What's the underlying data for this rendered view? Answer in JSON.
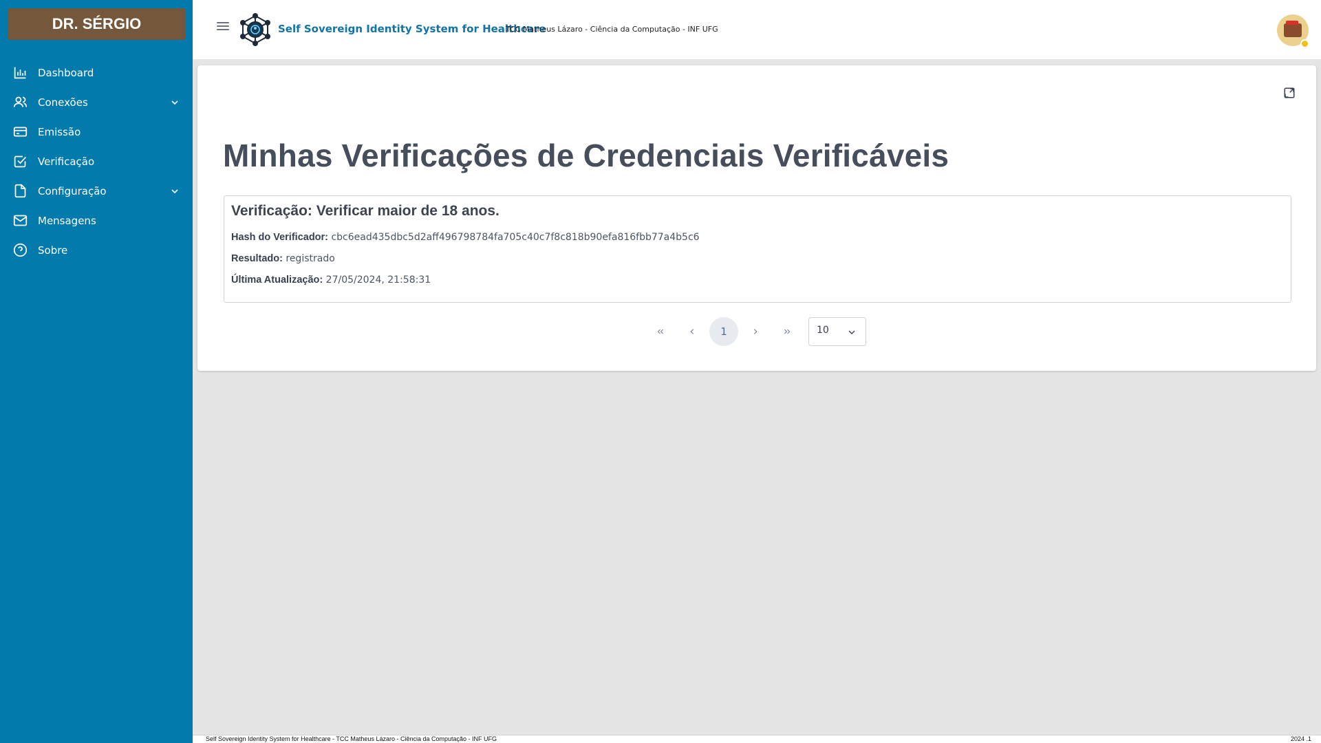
{
  "user": {
    "name": "DR. SÉRGIO"
  },
  "sidebar": {
    "items": [
      {
        "label": "Dashboard",
        "icon": "bar-chart-icon"
      },
      {
        "label": "Conexões",
        "icon": "users-icon",
        "expandable": true
      },
      {
        "label": "Emissão",
        "icon": "credit-card-icon"
      },
      {
        "label": "Verificação",
        "icon": "check-square-icon"
      },
      {
        "label": "Configuração",
        "icon": "file-icon",
        "expandable": true
      },
      {
        "label": "Mensagens",
        "icon": "mail-icon"
      },
      {
        "label": "Sobre",
        "icon": "help-circle-icon"
      }
    ]
  },
  "header": {
    "title": "Self Sovereign Identity System for Healthcare",
    "subtitle": "TCC Matheus Lázaro - Ciência da Computação - INF UFG"
  },
  "main": {
    "title": "Minhas Verificações de Credenciais Verificáveis",
    "verification": {
      "title": "Verificação: Verificar maior de 18 anos.",
      "hash_label": "Hash do Verificador:",
      "hash_value": "cbc6ead435dbc5d2aff496798784fa705c40c7f8c818b90efa816fbb77a4b5c6",
      "result_label": "Resultado:",
      "result_value": "registrado",
      "updated_label": "Última Atualização:",
      "updated_value": "27/05/2024, 21:58:31"
    },
    "pagination": {
      "current_page": "1",
      "per_page": "10"
    }
  },
  "footer": {
    "left": "Self Sovereign Identity System for Healthcare - TCC Matheus Lázaro - Ciência da Computação - INF UFG",
    "right": "2024 .1"
  },
  "colors": {
    "sidebar": "#027aac",
    "user_box": "#75583c",
    "accent": "#1273a5"
  }
}
